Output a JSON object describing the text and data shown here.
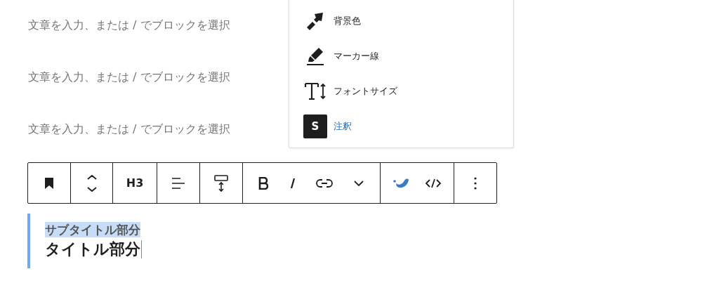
{
  "paragraphs": [
    {
      "placeholder": "文章を入力、または / でブロックを選択"
    },
    {
      "placeholder": "文章を入力、または / でブロックを選択"
    },
    {
      "placeholder": "文章を入力、または / でブロックを選択"
    }
  ],
  "format_menu": {
    "items": [
      {
        "kind": "brush",
        "label": "背景色"
      },
      {
        "kind": "marker",
        "label": "マーカー線"
      },
      {
        "kind": "font-size",
        "label": "フォントサイズ"
      },
      {
        "kind": "annotation",
        "badge": "S",
        "label": "注釈"
      }
    ]
  },
  "toolbar": {
    "groups": [
      [
        {
          "kind": "bookmark"
        }
      ],
      [
        {
          "kind": "move"
        }
      ],
      [
        {
          "kind": "text",
          "label": "H3"
        }
      ],
      [
        {
          "kind": "align"
        }
      ],
      [
        {
          "kind": "height"
        }
      ],
      [
        {
          "kind": "bold"
        },
        {
          "kind": "italic"
        },
        {
          "kind": "link"
        },
        {
          "kind": "more-formats"
        }
      ],
      [
        {
          "kind": "drop"
        },
        {
          "kind": "code"
        }
      ],
      [
        {
          "kind": "options"
        }
      ]
    ]
  },
  "heading_block": {
    "subtitle": {
      "text": "サブタイトル部分",
      "selected": true
    },
    "title": {
      "text": "タイトル部分"
    }
  }
}
